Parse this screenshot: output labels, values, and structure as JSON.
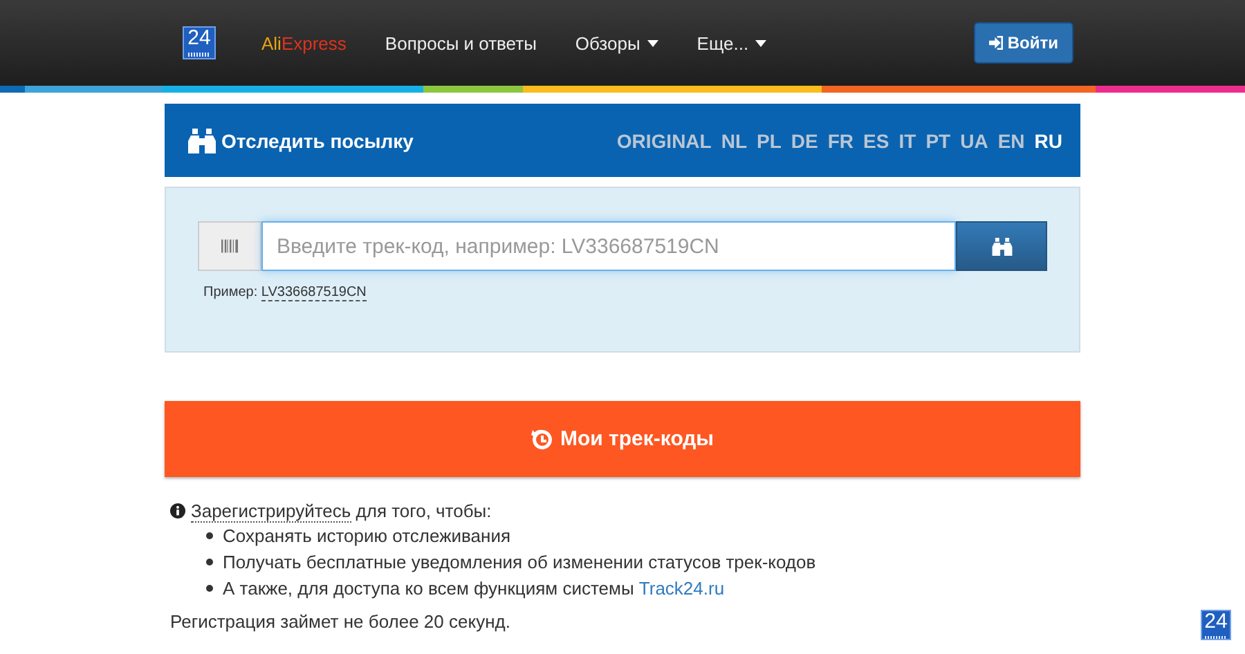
{
  "header": {
    "logo": "24",
    "brand": {
      "first": "Ali",
      "second": "Express"
    },
    "nav": [
      {
        "label": "Вопросы и ответы",
        "dropdown": false
      },
      {
        "label": "Обзоры",
        "dropdown": true
      },
      {
        "label": "Еще...",
        "dropdown": true
      }
    ],
    "login": "Войти"
  },
  "tracker": {
    "title": "Отследить посылку",
    "languages": [
      {
        "label": "ORIGINAL",
        "selected": false
      },
      {
        "label": "NL",
        "selected": false
      },
      {
        "label": "PL",
        "selected": false
      },
      {
        "label": "DE",
        "selected": false
      },
      {
        "label": "FR",
        "selected": false
      },
      {
        "label": "ES",
        "selected": false
      },
      {
        "label": "IT",
        "selected": false
      },
      {
        "label": "PT",
        "selected": false
      },
      {
        "label": "UA",
        "selected": false
      },
      {
        "label": "EN",
        "selected": false
      },
      {
        "label": "RU",
        "selected": true
      }
    ],
    "search": {
      "placeholder": "Введите трек-код, например: LV336687519CN"
    },
    "example_label": "Пример:",
    "example_code": "LV336687519CN"
  },
  "my_codes": "Мои трек-коды",
  "register": {
    "link": "Зарегистрируйтесь",
    "text": " для того, чтобы:",
    "bullets": [
      {
        "text": "Сохранять историю отслеживания"
      },
      {
        "text": "Получать бесплатные уведомления об изменении статусов трек-кодов"
      },
      {
        "text": "А также, для доступа ко всем функциям системы ",
        "link": "Track24.ru"
      }
    ],
    "note": "Регистрация займет не более 20 секунд."
  },
  "corner_logo": "24"
}
